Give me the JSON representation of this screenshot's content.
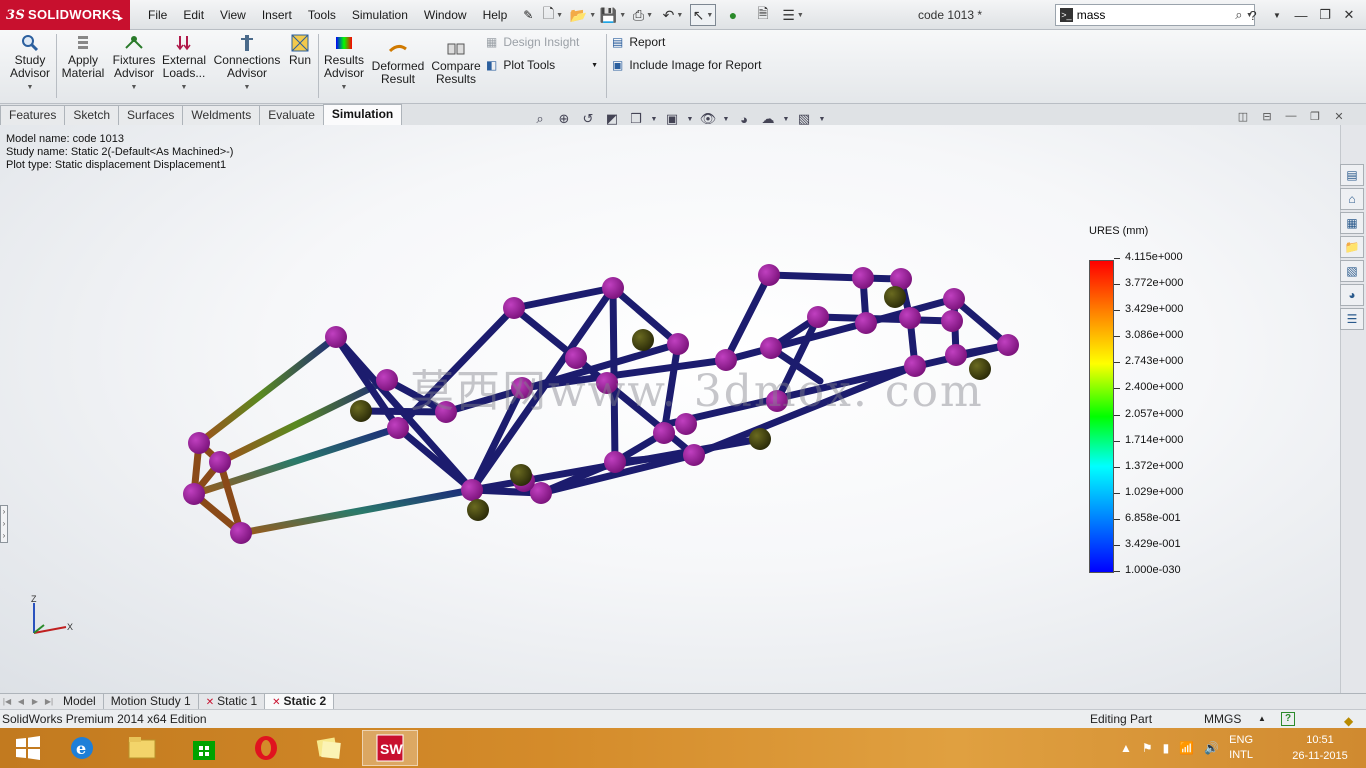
{
  "app": {
    "logo_text": "SOLIDWORKS",
    "logo_prefix": "3S",
    "document_title": "code 1013 *"
  },
  "menu": [
    "File",
    "Edit",
    "View",
    "Insert",
    "Tools",
    "Simulation",
    "Window",
    "Help"
  ],
  "search": {
    "value": "mass",
    "placeholder": ""
  },
  "command_manager": {
    "study_advisor": [
      "Study",
      "Advisor"
    ],
    "apply_material": [
      "Apply",
      "Material"
    ],
    "fixtures_advisor": [
      "Fixtures",
      "Advisor"
    ],
    "external_loads": [
      "External",
      "Loads..."
    ],
    "connections_advisor": [
      "Connections",
      "Advisor"
    ],
    "run": "Run",
    "results_advisor": [
      "Results",
      "Advisor"
    ],
    "deformed_result": [
      "Deformed",
      "Result"
    ],
    "compare_results": [
      "Compare",
      "Results"
    ],
    "design_insight": "Design Insight",
    "plot_tools": "Plot Tools",
    "report": "Report",
    "include_image": "Include Image for Report"
  },
  "tabs": [
    "Features",
    "Sketch",
    "Surfaces",
    "Weldments",
    "Evaluate",
    "Simulation"
  ],
  "active_tab": "Simulation",
  "viewport": {
    "model_name": "Model name: code 1013",
    "study_name": "Study name: Static 2(-Default<As Machined>-)",
    "plot_type": "Plot type: Static displacement Displacement1",
    "watermark": "莫西网www. 3dmox. com"
  },
  "legend": {
    "title": "URES (mm)",
    "labels": [
      "4.115e+000",
      "3.772e+000",
      "3.429e+000",
      "3.086e+000",
      "2.743e+000",
      "2.400e+000",
      "2.057e+000",
      "1.714e+000",
      "1.372e+000",
      "1.029e+000",
      "6.858e-001",
      "3.429e-001",
      "1.000e-030"
    ],
    "color_top": "#ff0000",
    "color_bottom": "#0000ff"
  },
  "triad": {
    "x": "X",
    "z": "Z"
  },
  "bottom_tabs": [
    "Model",
    "Motion Study 1",
    "Static 1",
    "Static 2"
  ],
  "active_bottom_tab": "Static 2",
  "status": {
    "edition": "SolidWorks Premium 2014 x64 Edition",
    "editing": "Editing Part",
    "units": "MMGS",
    "help": "?"
  },
  "taskbar": {
    "apps": [
      "start-icon",
      "internet-explorer-icon",
      "file-explorer-icon",
      "store-icon",
      "opera-icon",
      "sticky-notes-icon",
      "solidworks-icon"
    ],
    "lang_top": "ENG",
    "lang_bottom": "INTL",
    "time": "10:51",
    "date": "26-11-2015"
  },
  "colors": {
    "frame_member": "#1c1c6e",
    "node_joint": "#8b1a8b",
    "node_fixed": "#3a3a10",
    "brand_red": "#c8102e"
  }
}
